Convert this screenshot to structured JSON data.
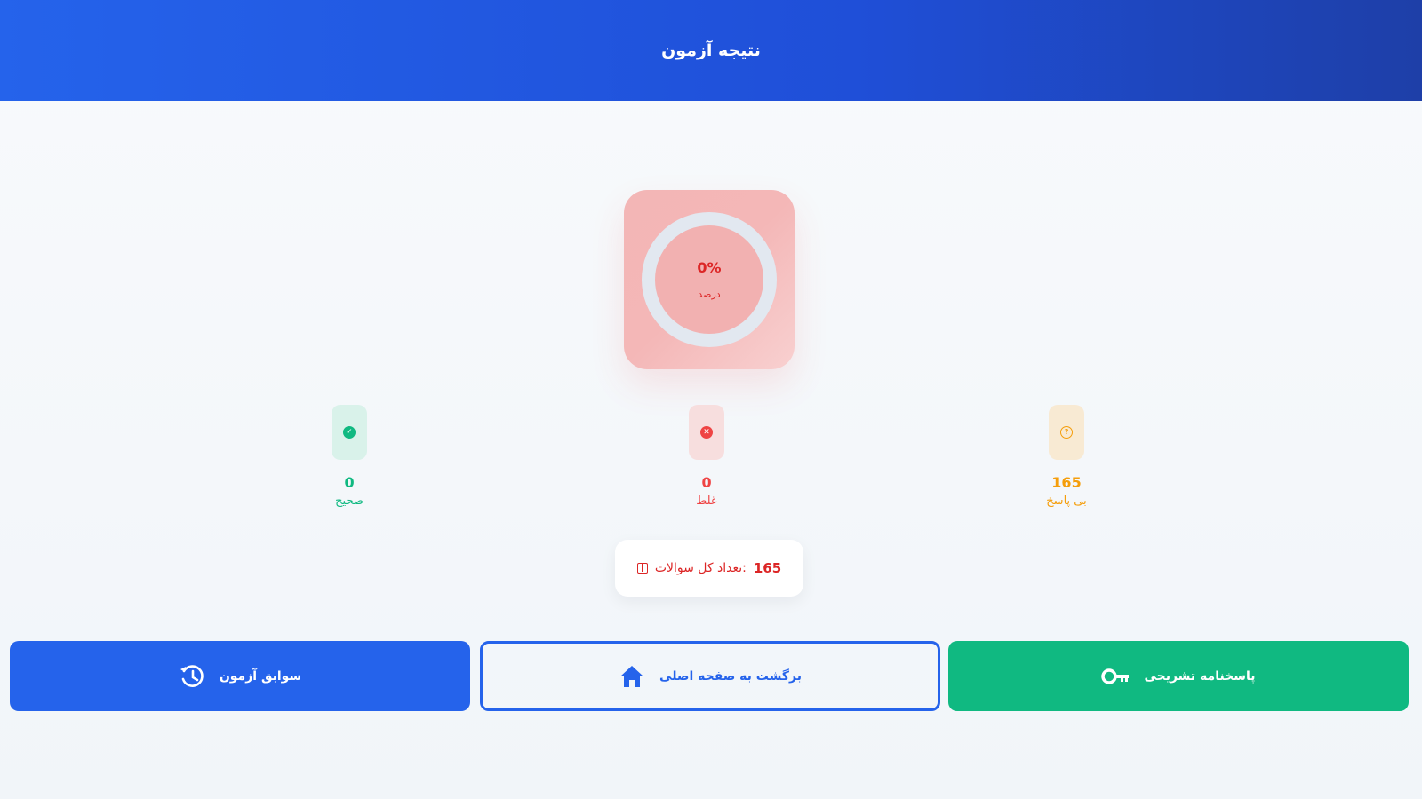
{
  "header": {
    "title": "نتیجه آزمون"
  },
  "score": {
    "value": "0%",
    "label": "درصد",
    "percent": 0
  },
  "stats": {
    "correct": {
      "value": "0",
      "label": "صحیح",
      "icon": "check-circle-icon",
      "color": "#10b981"
    },
    "wrong": {
      "value": "0",
      "label": "غلط",
      "icon": "x-circle-icon",
      "color": "#ef4444"
    },
    "unanswered": {
      "value": "165",
      "label": "بی پاسخ",
      "icon": "question-circle-icon",
      "color": "#f59e0b"
    }
  },
  "total": {
    "label": ":تعداد کل سوالات",
    "value": "165",
    "icon": "list-icon"
  },
  "buttons": {
    "answers": {
      "label": "پاسخنامه تشریحی",
      "icon": "key-icon",
      "color": "#10b981"
    },
    "home": {
      "label": "برگشت به صفحه اصلی",
      "icon": "home-icon",
      "color": "#2563eb"
    },
    "history": {
      "label": "سوابق آزمون",
      "icon": "history-icon",
      "color": "#2563eb"
    }
  }
}
